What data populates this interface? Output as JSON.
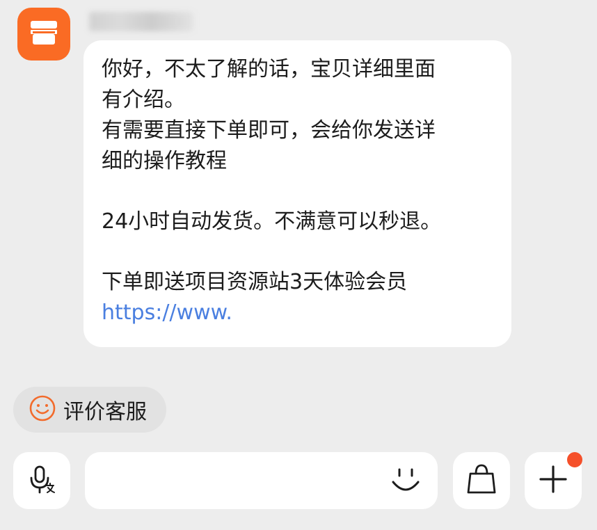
{
  "chat": {
    "message": {
      "lines": [
        "你好，不太了解的话，宝贝详细里面",
        "有介绍。",
        "有需要直接下单即可，会给你发送详",
        "细的操作教程",
        "24小时自动发货。不满意可以秒退。",
        "下单即送项目资源站3天体验会员"
      ],
      "link": "https://www."
    },
    "rate_label": "评价客服"
  },
  "input": {
    "placeholder": ""
  },
  "colors": {
    "accent": "#fa6b24",
    "link": "#4a7fe0",
    "badge": "#f5502a",
    "background": "#ededed"
  },
  "icons": {
    "avatar": "store-icon",
    "rate": "smiley-icon",
    "voice": "microphone-translate-icon",
    "emoji": "smile-icon",
    "shop": "shopping-bag-icon",
    "more": "plus-icon"
  }
}
